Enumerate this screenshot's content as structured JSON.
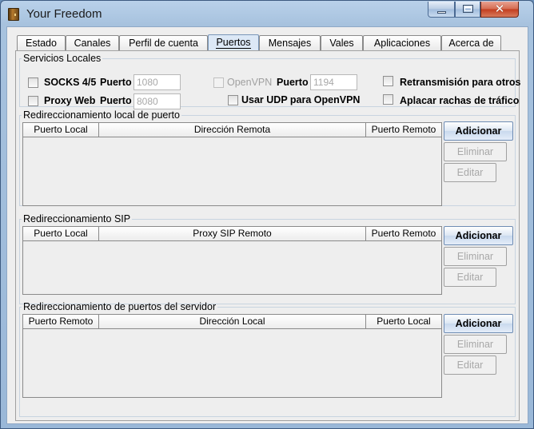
{
  "window": {
    "title": "Your Freedom"
  },
  "tabs": [
    {
      "label": "Estado"
    },
    {
      "label": "Canales"
    },
    {
      "label": "Perfil de cuenta"
    },
    {
      "label": "Puertos"
    },
    {
      "label": "Mensajes"
    },
    {
      "label": "Vales"
    },
    {
      "label": "Aplicaciones"
    },
    {
      "label": "Acerca de"
    }
  ],
  "active_tab": "Puertos",
  "services": {
    "title": "Servicios Locales",
    "socks": {
      "label": "SOCKS 4/5",
      "port_label": "Puerto",
      "port_value": "1080"
    },
    "proxy": {
      "label": "Proxy Web",
      "port_label": "Puerto",
      "port_value": "8080"
    },
    "openvpn": {
      "label": "OpenVPN",
      "port_label": "Puerto",
      "port_value": "1194"
    },
    "udp": {
      "label": "Usar UDP para OpenVPN"
    },
    "retrans": {
      "label": "Retransmisión para otros"
    },
    "burst": {
      "label": "Aplacar rachas de tráfico"
    }
  },
  "local_fwd": {
    "title": "Redireccionamiento local de puerto",
    "columns": [
      "Puerto Local",
      "Dirección Remota",
      "Puerto Remoto"
    ],
    "add": "Adicionar",
    "remove": "Eliminar",
    "edit": "Editar"
  },
  "sip_fwd": {
    "title": "Redireccionamiento SIP",
    "columns": [
      "Puerto Local",
      "Proxy SIP Remoto",
      "Puerto Remoto"
    ],
    "add": "Adicionar",
    "remove": "Eliminar",
    "edit": "Editar"
  },
  "server_fwd": {
    "title": "Redireccionamiento de puertos del servidor",
    "columns": [
      "Puerto Remoto",
      "Dirección Local",
      "Puerto Local"
    ],
    "add": "Adicionar",
    "remove": "Eliminar",
    "edit": "Editar"
  }
}
